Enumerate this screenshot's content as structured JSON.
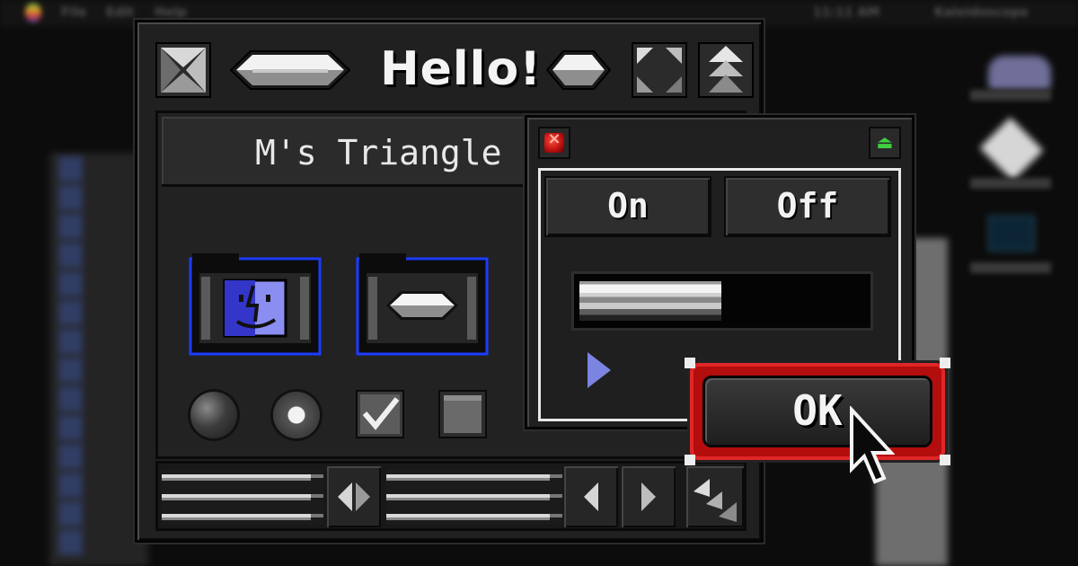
{
  "menubar": {
    "items": [
      "File",
      "Edit",
      "Help"
    ],
    "clock": "11:11 AM",
    "app_name": "Kaleidoscope"
  },
  "window": {
    "title": "Hello!",
    "header": "M's Triangle G"
  },
  "dialog": {
    "toggle_on": "On",
    "toggle_off": "Off",
    "progress": 0.48,
    "ok_label": "OK"
  },
  "colors": {
    "accent_red": "#b30d0d",
    "folder_border": "#1c3cff",
    "collapse_green": "#3ecf3e"
  },
  "icons": {
    "close": "close-box-icon",
    "zoom": "zoom-box-icon",
    "collapse": "windowshade-icon",
    "finder": "finder-face-icon"
  }
}
